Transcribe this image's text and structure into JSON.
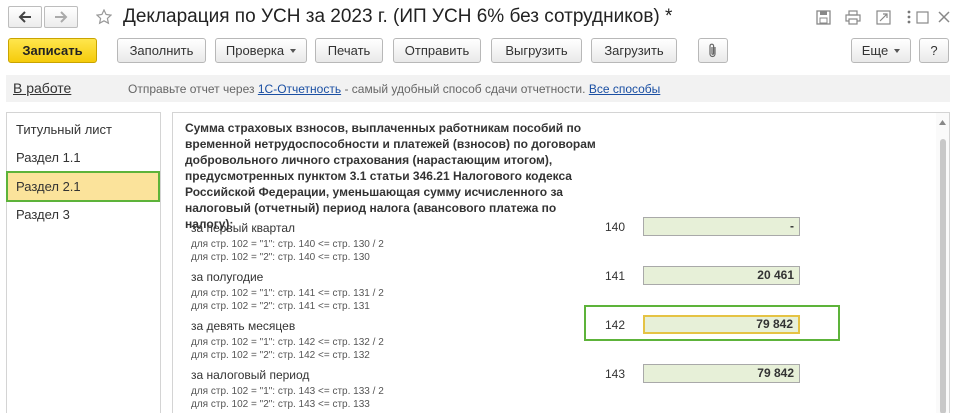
{
  "window": {
    "title": "Декларация по УСН за 2023 г. (ИП УСН 6% без сотрудников) *"
  },
  "toolbar": {
    "save": "Записать",
    "fill": "Заполнить",
    "check": "Проверка",
    "print": "Печать",
    "send": "Отправить",
    "upload": "Выгрузить",
    "load": "Загрузить",
    "more": "Еще",
    "help": "?"
  },
  "status": {
    "state": "В работе",
    "message_prefix": "Отправьте отчет через",
    "service_link": "1С-Отчетность",
    "message_suffix": "- самый удобный способ сдачи отчетности.",
    "all_methods_link": "Все способы"
  },
  "sections": [
    {
      "label": "Титульный лист"
    },
    {
      "label": "Раздел 1.1"
    },
    {
      "label": "Раздел 2.1"
    },
    {
      "label": "Раздел 3"
    }
  ],
  "content": {
    "heading": "Сумма страховых взносов, выплаченных работникам пособий по временной нетрудоспособности и платежей (взносов) по договорам добровольного личного страхования (нарастающим итогом), предусмотренных пунктом 3.1 статьи 346.21 Налогового кодекса Российской Федерации, уменьшающая сумму исчисленного за налоговый (отчетный) период налога (авансового платежа по налогу):",
    "rows": [
      {
        "label": "за первый квартал",
        "hint1": "для стр. 102 = \"1\": стр. 140 <= стр. 130 / 2",
        "hint2": "для стр. 102 = \"2\": стр. 140 <= стр. 130",
        "code": "140",
        "value": "-"
      },
      {
        "label": "за полугодие",
        "hint1": "для стр. 102 = \"1\": стр. 141 <= стр. 131 / 2",
        "hint2": "для стр. 102 = \"2\": стр. 141 <= стр. 131",
        "code": "141",
        "value": "20 461"
      },
      {
        "label": "за девять месяцев",
        "hint1": "для стр. 102 = \"1\": стр. 142 <= стр. 132 / 2",
        "hint2": "для стр. 102 = \"2\": стр. 142 <= стр. 132",
        "code": "142",
        "value": "79 842"
      },
      {
        "label": "за налоговый период",
        "hint1": "для стр. 102 = \"1\": стр. 143 <= стр. 133 / 2",
        "hint2": "для стр. 102 = \"2\": стр. 143 <= стр. 133",
        "code": "143",
        "value": "79 842"
      }
    ]
  },
  "icons": {
    "back": "arrow-left-icon",
    "forward": "arrow-right-icon",
    "star": "star-icon",
    "save_disk": "floppy-icon",
    "printer": "printer-icon",
    "link": "link-icon",
    "more_vert": "more-vertical-icon",
    "maximize": "maximize-icon",
    "close": "close-icon",
    "attach": "paperclip-icon"
  },
  "colors": {
    "primary_button": "#f5cb0b",
    "active_section": "#fbe39b",
    "highlight_outline": "#5db33a",
    "field_bg": "#e7f0d8",
    "link": "#1a4fa3"
  }
}
